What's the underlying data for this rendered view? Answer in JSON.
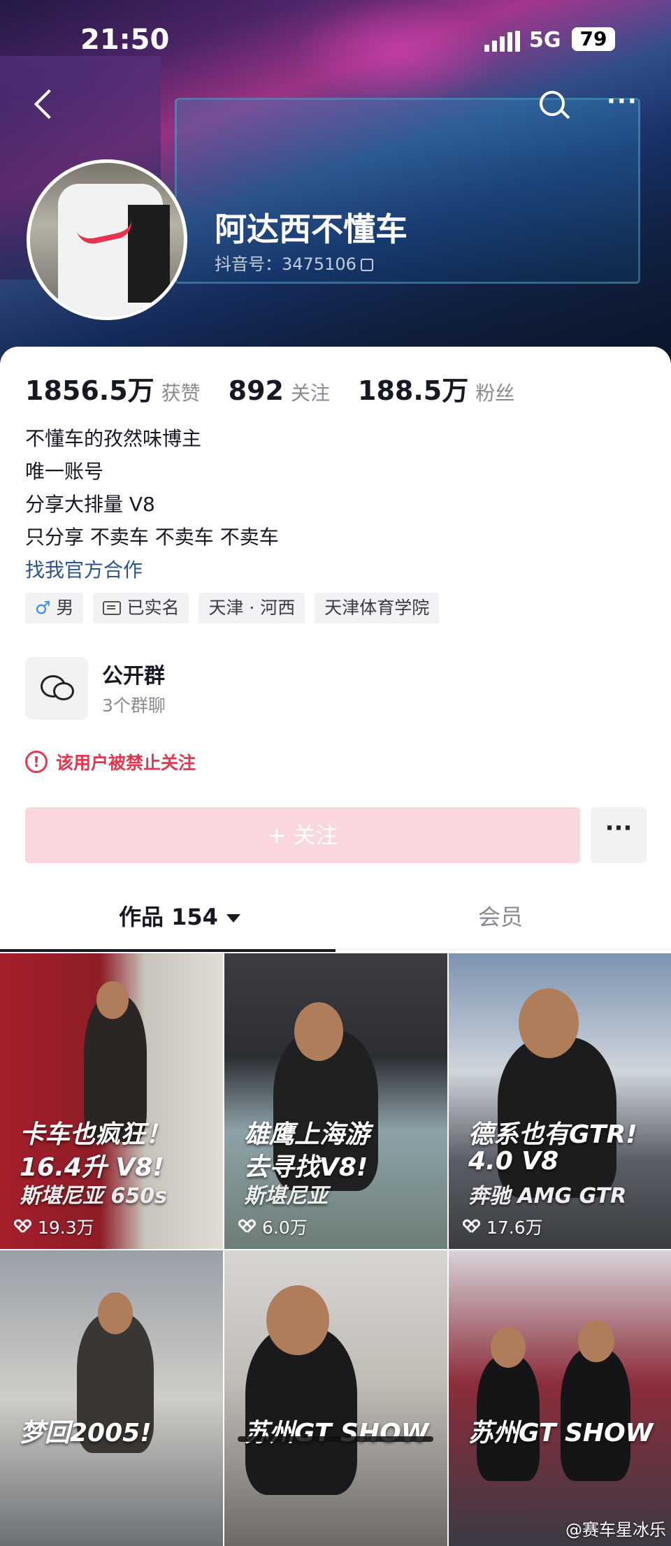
{
  "status_bar": {
    "time": "21:50",
    "network": "5G",
    "battery": "79"
  },
  "profile": {
    "name": "阿达西不懂车",
    "douyin_id": "抖音号：3475106",
    "stats": [
      {
        "num": "1856.5万",
        "label": "获赞"
      },
      {
        "num": "892",
        "label": "关注"
      },
      {
        "num": "188.5万",
        "label": "粉丝"
      }
    ],
    "bio": [
      "不懂车的孜然味博主",
      "唯一账号",
      "分享大排量 V8",
      "只分享 不卖车 不卖车 不卖车"
    ],
    "bio_link": "找我官方合作",
    "tags": [
      {
        "icon": "male-icon",
        "text": "男"
      },
      {
        "icon": "id-card-icon",
        "text": "已实名"
      },
      {
        "icon": "",
        "text": "天津 · 河西"
      },
      {
        "icon": "",
        "text": "天津体育学院"
      }
    ]
  },
  "group": {
    "title": "公开群",
    "subtitle": "3个群聊"
  },
  "ban_notice": "该用户被禁止关注",
  "follow_button": "+ 关注",
  "more_button": "···",
  "tabs": [
    {
      "label": "作品 154",
      "active": true
    },
    {
      "label": "会员",
      "active": false
    }
  ],
  "videos": [
    {
      "line1": "卡车也疯狂！",
      "line2": "16.4升 V8!",
      "line3": "斯堪尼亚 650s",
      "likes": "19.3万",
      "colors": [
        "#a41f2b",
        "#c8c4bc"
      ]
    },
    {
      "line1": "雄鹰上海游",
      "line2": "去寻找V8!",
      "line3": "斯堪尼亚",
      "likes": "6.0万",
      "colors": [
        "#3b3d42",
        "#8da3a9"
      ]
    },
    {
      "line1": "德系也有GTR!",
      "line2": "4.0 V8",
      "line3": "奔驰 AMG GTR",
      "likes": "17.6万",
      "colors": [
        "#7c93b0",
        "#cfd5dc"
      ]
    },
    {
      "line1": "梦回2005!",
      "line2": "",
      "line3": "",
      "likes": "",
      "colors": [
        "#9aa0a8",
        "#cfcdc8"
      ]
    },
    {
      "line1": "苏州GT SHOW",
      "line2": "",
      "line3": "",
      "likes": "",
      "colors": [
        "#d8d6d2",
        "#6d6a66"
      ]
    },
    {
      "line1": "苏州GT SHOW",
      "line2": "",
      "line3": "",
      "likes": "",
      "colors": [
        "#8c2d3a",
        "#3b3a44"
      ]
    }
  ],
  "watermark": "@赛车星冰乐"
}
